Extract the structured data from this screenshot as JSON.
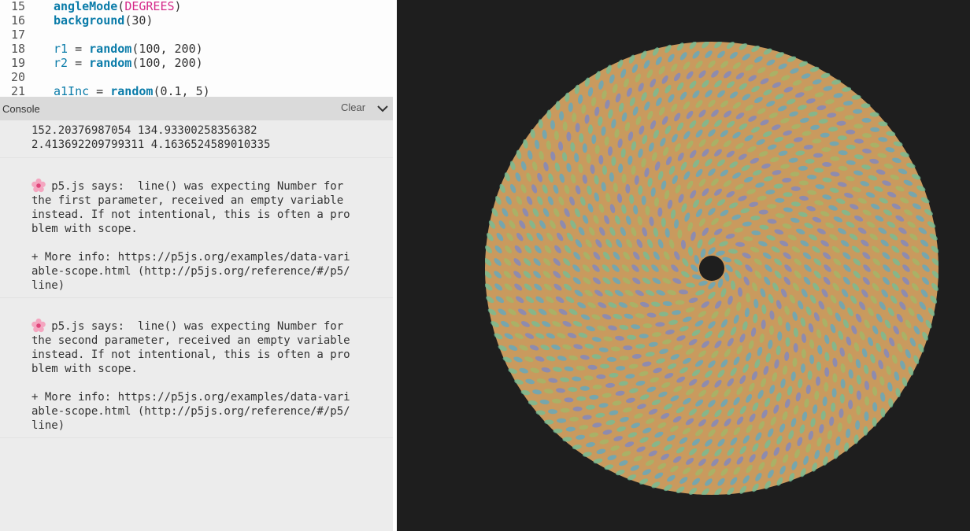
{
  "editor": {
    "lines": [
      {
        "num": "15",
        "tokens": [
          {
            "t": "angleMode",
            "k": "fn"
          },
          {
            "t": "(",
            "k": "plain"
          },
          {
            "t": "DEGREES",
            "k": "const"
          },
          {
            "t": ")",
            "k": "plain"
          }
        ]
      },
      {
        "num": "16",
        "tokens": [
          {
            "t": "background",
            "k": "fn"
          },
          {
            "t": "(30)",
            "k": "plain"
          }
        ]
      },
      {
        "num": "17",
        "tokens": []
      },
      {
        "num": "18",
        "tokens": [
          {
            "t": "r1",
            "k": "var"
          },
          {
            "t": " = ",
            "k": "plain"
          },
          {
            "t": "random",
            "k": "fn"
          },
          {
            "t": "(100, 200)",
            "k": "plain"
          }
        ]
      },
      {
        "num": "19",
        "tokens": [
          {
            "t": "r2",
            "k": "var"
          },
          {
            "t": " = ",
            "k": "plain"
          },
          {
            "t": "random",
            "k": "fn"
          },
          {
            "t": "(100, 200)",
            "k": "plain"
          }
        ]
      },
      {
        "num": "20",
        "tokens": []
      },
      {
        "num": "21",
        "tokens": [
          {
            "t": "a1Inc",
            "k": "var"
          },
          {
            "t": " = ",
            "k": "plain"
          },
          {
            "t": "random",
            "k": "fn"
          },
          {
            "t": "(0.1, 5)",
            "k": "plain"
          }
        ]
      }
    ]
  },
  "console": {
    "title": "Console",
    "clear_label": "Clear",
    "chevron_icon": "chevron-down-icon",
    "log_output": "152.20376987054 134.93300258356382\n2.413692209799311 4.1636524589010335",
    "messages": [
      {
        "icon": "flower-icon",
        "text": "   p5.js says:  line() was expecting Number for\nthe first parameter, received an empty variable\ninstead. If not intentional, this is often a pro\nblem with scope.\n\n+ More info: https://p5js.org/examples/data-vari\nable-scope.html (http://p5js.org/reference/#/p5/\nline)"
      },
      {
        "icon": "flower-icon",
        "text": "   p5.js says:  line() was expecting Number for\nthe second parameter, received an empty variable\ninstead. If not intentional, this is often a pro\nblem with scope.\n\n+ More info: https://p5js.org/examples/data-vari\nable-scope.html (http://p5js.org/reference/#/p5/\nline)"
      }
    ]
  },
  "sketch": {
    "background_color": "#1e1e1e",
    "disc_color": "#c99a5e",
    "ring_colors": [
      "#5aa9c8",
      "#6fbf9a",
      "#7a86c9",
      "#9fb86a"
    ],
    "hole_color": "#1e1e1e"
  }
}
